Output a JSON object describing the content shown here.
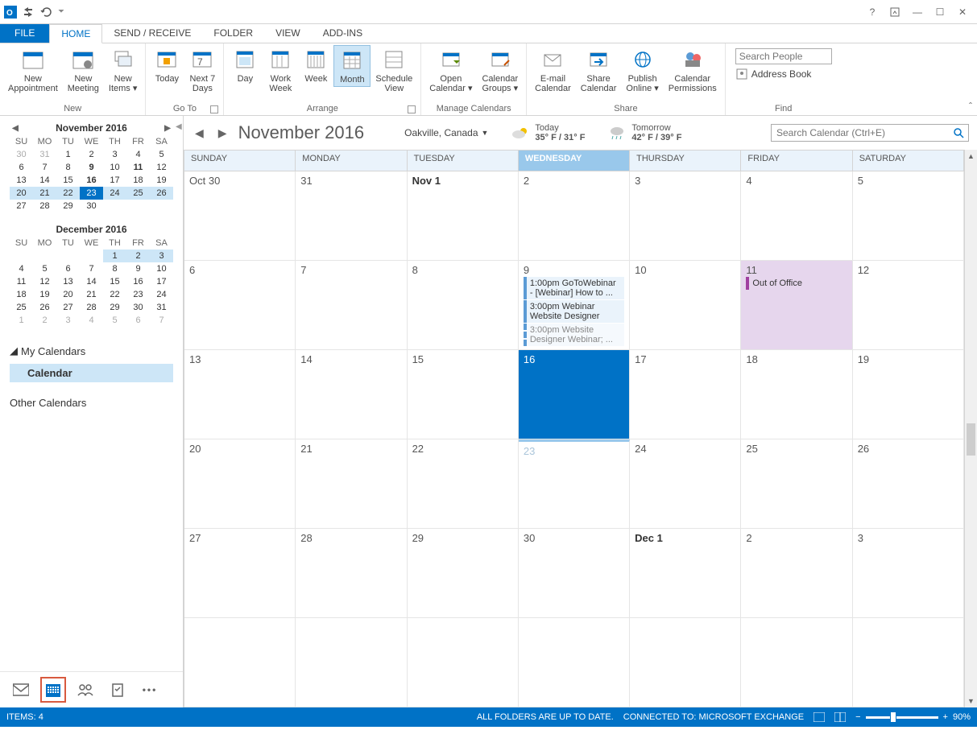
{
  "titlebar": {
    "help": "?",
    "minimize": "—",
    "maximize": "☐",
    "close": "✕"
  },
  "tabs": {
    "file": "FILE",
    "home": "HOME",
    "sendreceive": "SEND / RECEIVE",
    "folder": "FOLDER",
    "view": "VIEW",
    "addins": "ADD-INS"
  },
  "ribbon": {
    "new_appointment": "New\nAppointment",
    "new_meeting": "New\nMeeting",
    "new_items": "New\nItems ▾",
    "new_group": "New",
    "today": "Today",
    "next7": "Next 7\nDays",
    "goto_group": "Go To",
    "day": "Day",
    "work_week": "Work\nWeek",
    "week": "Week",
    "month": "Month",
    "schedule_view": "Schedule\nView",
    "arrange_group": "Arrange",
    "open_calendar": "Open\nCalendar ▾",
    "calendar_groups": "Calendar\nGroups ▾",
    "manage_group": "Manage Calendars",
    "email_calendar": "E-mail\nCalendar",
    "share_calendar": "Share\nCalendar",
    "publish_online": "Publish\nOnline ▾",
    "calendar_permissions": "Calendar\nPermissions",
    "share_group": "Share",
    "search_people_placeholder": "Search People",
    "address_book": "Address Book",
    "find_group": "Find"
  },
  "minicalendars": [
    {
      "title": "November 2016",
      "dow": [
        "SU",
        "MO",
        "TU",
        "WE",
        "TH",
        "FR",
        "SA"
      ],
      "weeks": [
        [
          {
            "d": "30",
            "dim": true
          },
          {
            "d": "31",
            "dim": true
          },
          {
            "d": "1"
          },
          {
            "d": "2"
          },
          {
            "d": "3"
          },
          {
            "d": "4"
          },
          {
            "d": "5"
          }
        ],
        [
          {
            "d": "6"
          },
          {
            "d": "7"
          },
          {
            "d": "8"
          },
          {
            "d": "9",
            "bold": true
          },
          {
            "d": "10"
          },
          {
            "d": "11",
            "bold": true
          },
          {
            "d": "12"
          }
        ],
        [
          {
            "d": "13"
          },
          {
            "d": "14"
          },
          {
            "d": "15"
          },
          {
            "d": "16",
            "bold": true
          },
          {
            "d": "17"
          },
          {
            "d": "18"
          },
          {
            "d": "19"
          }
        ],
        [
          {
            "d": "20",
            "hl": true
          },
          {
            "d": "21",
            "hl": true
          },
          {
            "d": "22",
            "hl": true
          },
          {
            "d": "23",
            "today": true
          },
          {
            "d": "24",
            "hl": true
          },
          {
            "d": "25",
            "hl": true
          },
          {
            "d": "26",
            "hl": true
          }
        ],
        [
          {
            "d": "27"
          },
          {
            "d": "28"
          },
          {
            "d": "29"
          },
          {
            "d": "30"
          },
          {
            "d": ""
          },
          {
            "d": ""
          },
          {
            "d": ""
          }
        ]
      ]
    },
    {
      "title": "December 2016",
      "dow": [
        "SU",
        "MO",
        "TU",
        "WE",
        "TH",
        "FR",
        "SA"
      ],
      "weeks": [
        [
          {
            "d": ""
          },
          {
            "d": ""
          },
          {
            "d": ""
          },
          {
            "d": ""
          },
          {
            "d": "1",
            "hl": true
          },
          {
            "d": "2",
            "hl": true
          },
          {
            "d": "3",
            "hl": true
          }
        ],
        [
          {
            "d": "4"
          },
          {
            "d": "5"
          },
          {
            "d": "6"
          },
          {
            "d": "7"
          },
          {
            "d": "8"
          },
          {
            "d": "9"
          },
          {
            "d": "10"
          }
        ],
        [
          {
            "d": "11"
          },
          {
            "d": "12"
          },
          {
            "d": "13"
          },
          {
            "d": "14"
          },
          {
            "d": "15"
          },
          {
            "d": "16"
          },
          {
            "d": "17"
          }
        ],
        [
          {
            "d": "18"
          },
          {
            "d": "19"
          },
          {
            "d": "20"
          },
          {
            "d": "21"
          },
          {
            "d": "22"
          },
          {
            "d": "23"
          },
          {
            "d": "24"
          }
        ],
        [
          {
            "d": "25"
          },
          {
            "d": "26"
          },
          {
            "d": "27"
          },
          {
            "d": "28"
          },
          {
            "d": "29"
          },
          {
            "d": "30"
          },
          {
            "d": "31"
          }
        ],
        [
          {
            "d": "1",
            "dim": true
          },
          {
            "d": "2",
            "dim": true
          },
          {
            "d": "3",
            "dim": true
          },
          {
            "d": "4",
            "dim": true
          },
          {
            "d": "5",
            "dim": true
          },
          {
            "d": "6",
            "dim": true
          },
          {
            "d": "7",
            "dim": true
          }
        ]
      ]
    }
  ],
  "cal_list": {
    "my_calendars": "My Calendars",
    "calendar": "Calendar",
    "other_calendars": "Other Calendars"
  },
  "calview": {
    "title": "November 2016",
    "location": "Oakville, Canada",
    "weather_today_label": "Today",
    "weather_today_temp": "35° F / 31° F",
    "weather_tomorrow_label": "Tomorrow",
    "weather_tomorrow_temp": "42° F / 39° F",
    "search_placeholder": "Search Calendar (Ctrl+E)",
    "day_headers": [
      "SUNDAY",
      "MONDAY",
      "TUESDAY",
      "WEDNESDAY",
      "THURSDAY",
      "FRIDAY",
      "SATURDAY"
    ],
    "cells": [
      [
        {
          "label": "Oct 30"
        },
        {
          "label": "31"
        },
        {
          "label": "Nov 1",
          "bold": true
        },
        {
          "label": "2"
        },
        {
          "label": "3"
        },
        {
          "label": "4"
        },
        {
          "label": "5"
        }
      ],
      [
        {
          "label": "6"
        },
        {
          "label": "7"
        },
        {
          "label": "8"
        },
        {
          "label": "9",
          "events": [
            {
              "text": "1:00pm GoToWebinar - [Webinar] How to ..."
            },
            {
              "text": "3:00pm Webinar Website Designer"
            },
            {
              "text": "3:00pm Website Designer Webinar; ...",
              "tentative": true
            }
          ]
        },
        {
          "label": "10"
        },
        {
          "label": "11",
          "ooo": true,
          "events": [
            {
              "text": "Out of Office",
              "ooo": true
            }
          ]
        },
        {
          "label": "12"
        }
      ],
      [
        {
          "label": "13"
        },
        {
          "label": "14"
        },
        {
          "label": "15"
        },
        {
          "label": "16",
          "selected": true
        },
        {
          "label": "17"
        },
        {
          "label": "18"
        },
        {
          "label": "19"
        }
      ],
      [
        {
          "label": "20"
        },
        {
          "label": "21"
        },
        {
          "label": "22"
        },
        {
          "label": "23",
          "dim": true,
          "today": true
        },
        {
          "label": "24"
        },
        {
          "label": "25"
        },
        {
          "label": "26"
        }
      ],
      [
        {
          "label": "27"
        },
        {
          "label": "28"
        },
        {
          "label": "29"
        },
        {
          "label": "30"
        },
        {
          "label": "Dec 1",
          "bold": true
        },
        {
          "label": "2"
        },
        {
          "label": "3"
        }
      ],
      [
        {
          "label": ""
        },
        {
          "label": ""
        },
        {
          "label": ""
        },
        {
          "label": ""
        },
        {
          "label": ""
        },
        {
          "label": ""
        },
        {
          "label": ""
        }
      ]
    ]
  },
  "statusbar": {
    "items": "ITEMS: 4",
    "sync": "ALL FOLDERS ARE UP TO DATE.",
    "connected": "CONNECTED TO: MICROSOFT EXCHANGE",
    "zoom": "90%"
  }
}
